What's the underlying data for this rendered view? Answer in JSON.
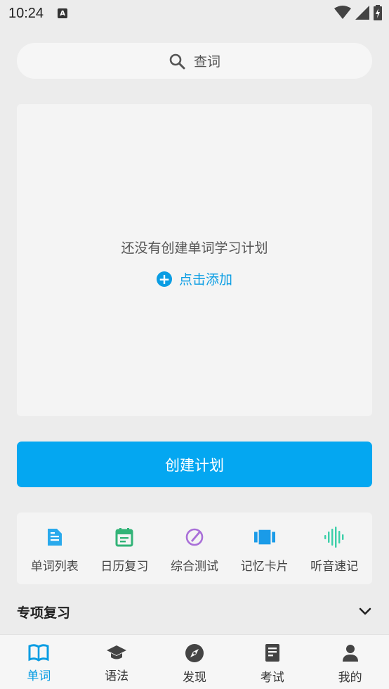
{
  "status_bar": {
    "time": "10:24",
    "notif_letter": "A"
  },
  "search": {
    "placeholder": "查词",
    "icon": "search-icon"
  },
  "plan_card": {
    "empty_text": "还没有创建单词学习计划",
    "add_label": "点击添加",
    "add_symbol": "+"
  },
  "create_button": {
    "label": "创建计划",
    "color": "#04a7f1"
  },
  "tools": [
    {
      "label": "单词列表",
      "icon": "document-icon",
      "color": "#29a9ec"
    },
    {
      "label": "日历复习",
      "icon": "calendar-icon",
      "color": "#32b377"
    },
    {
      "label": "综合测试",
      "icon": "compass-pen-icon",
      "color": "#a96fd8"
    },
    {
      "label": "记忆卡片",
      "icon": "cards-icon",
      "color": "#1a9be8"
    },
    {
      "label": "听音速记",
      "icon": "waveform-icon",
      "color": "#3ccfa9"
    }
  ],
  "section": {
    "title": "专项复习"
  },
  "tabbar": {
    "active_color": "#0a9de3",
    "items": [
      {
        "label": "单词",
        "icon": "book-icon",
        "active": true
      },
      {
        "label": "语法",
        "icon": "graduation-cap-icon",
        "active": false
      },
      {
        "label": "发现",
        "icon": "compass-icon",
        "active": false
      },
      {
        "label": "考试",
        "icon": "exam-paper-icon",
        "active": false
      },
      {
        "label": "我的",
        "icon": "person-icon",
        "active": false
      }
    ]
  }
}
